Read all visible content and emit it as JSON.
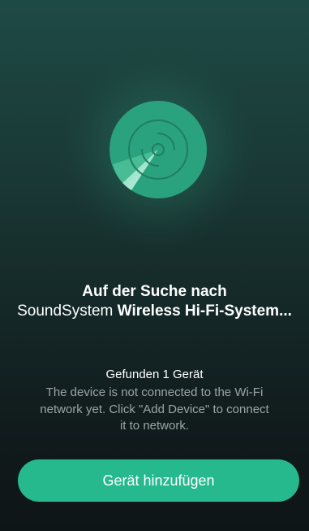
{
  "search": {
    "line1": "Auf der Suche nach",
    "brand": "SoundSystem",
    "product": "Wireless Hi-Fi-System..."
  },
  "status": {
    "found": "Gefunden 1 Gerät",
    "description": "The device is not connected to the Wi-Fi network yet. Click \"Add Device\" to connect it to network."
  },
  "action": {
    "add_label": "Gerät hinzufügen"
  },
  "colors": {
    "accent": "#26b98d",
    "radar_disc": "#2aa27d",
    "background_top": "#1e4a45",
    "background_bottom": "#0e1517"
  },
  "icons": {
    "radar": "radar-disc-icon"
  }
}
